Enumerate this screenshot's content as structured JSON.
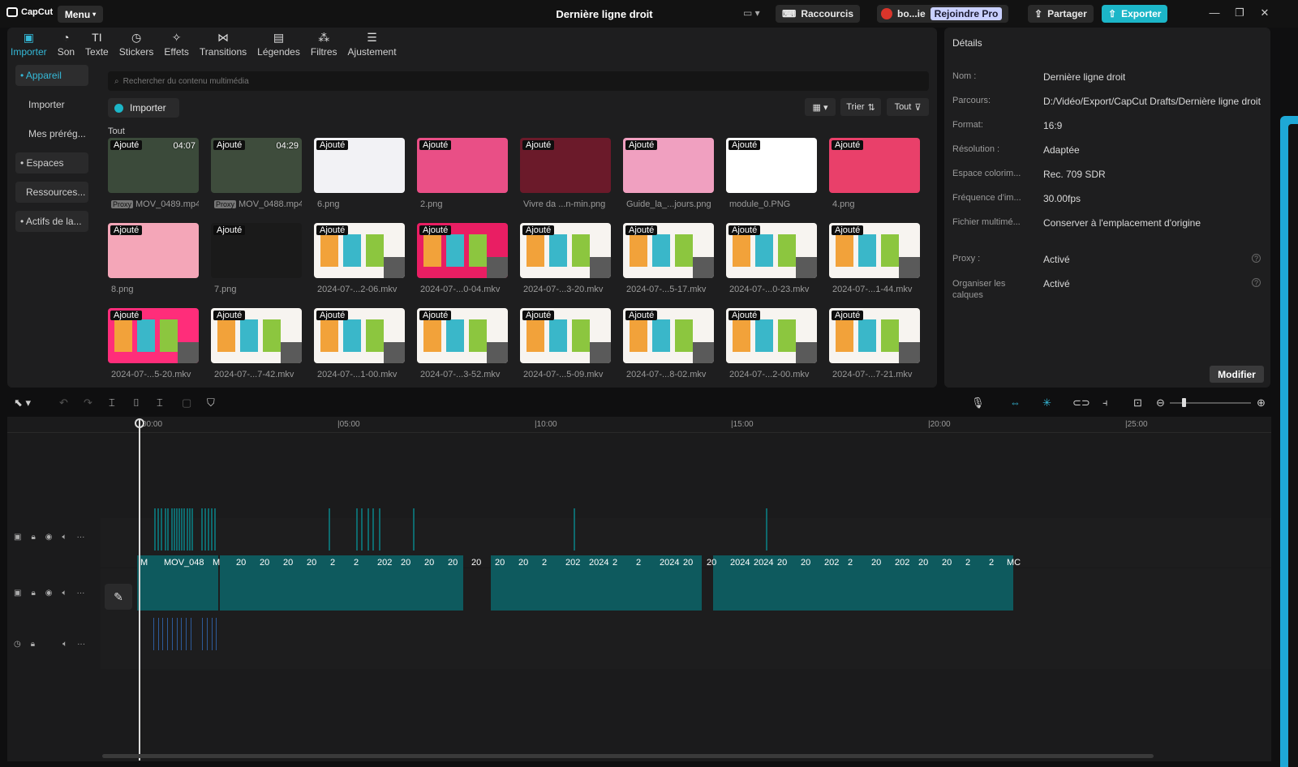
{
  "app": {
    "name": "CapCut",
    "menu": "Menu",
    "title": "Dernière ligne droit"
  },
  "titlebar": {
    "shortcuts": "Raccourcis",
    "account": "bo...ie",
    "join_pro": "Rejoindre Pro",
    "share": "Partager",
    "export": "Exporter"
  },
  "tools": [
    {
      "label": "Importer",
      "icon": "import-icon"
    },
    {
      "label": "Son",
      "icon": "audio-icon"
    },
    {
      "label": "Texte",
      "icon": "text-icon"
    },
    {
      "label": "Stickers",
      "icon": "sticker-icon"
    },
    {
      "label": "Effets",
      "icon": "effects-icon"
    },
    {
      "label": "Transitions",
      "icon": "transitions-icon"
    },
    {
      "label": "Légendes",
      "icon": "captions-icon"
    },
    {
      "label": "Filtres",
      "icon": "filters-icon"
    },
    {
      "label": "Ajustement",
      "icon": "adjust-icon"
    }
  ],
  "sidebar": [
    {
      "label": "• Appareil"
    },
    {
      "label": "Importer"
    },
    {
      "label": "Mes prérég..."
    },
    {
      "label": "• Espaces"
    },
    {
      "label": "Ressources..."
    },
    {
      "label": "• Actifs de la..."
    }
  ],
  "media": {
    "search_placeholder": "Rechercher du contenu multimédia",
    "import_label": "Importer",
    "sort_label": "Trier",
    "filter_label": "Tout",
    "section_label": "Tout",
    "badge": "Ajouté",
    "proxy": "Proxy",
    "items": [
      {
        "name": "MOV_0489.mp4",
        "duration": "04:07",
        "proxy": true
      },
      {
        "name": "MOV_0488.mp4",
        "duration": "04:29",
        "proxy": true
      },
      {
        "name": "6.png"
      },
      {
        "name": "2.png"
      },
      {
        "name": "Vivre da ...n-min.png"
      },
      {
        "name": "Guide_la_...jours.png"
      },
      {
        "name": "module_0.PNG"
      },
      {
        "name": "4.png"
      },
      {
        "name": "8.png"
      },
      {
        "name": "7.png"
      },
      {
        "name": "2024-07-...2-06.mkv"
      },
      {
        "name": "2024-07-...0-04.mkv"
      },
      {
        "name": "2024-07-...3-20.mkv"
      },
      {
        "name": "2024-07-...5-17.mkv"
      },
      {
        "name": "2024-07-...0-23.mkv"
      },
      {
        "name": "2024-07-...1-44.mkv"
      },
      {
        "name": "2024-07-...5-20.mkv"
      },
      {
        "name": "2024-07-...7-42.mkv"
      },
      {
        "name": "2024-07-...1-00.mkv"
      },
      {
        "name": "2024-07-...3-52.mkv"
      },
      {
        "name": "2024-07-...5-09.mkv"
      },
      {
        "name": "2024-07-...8-02.mkv"
      },
      {
        "name": "2024-07-...2-00.mkv"
      },
      {
        "name": "2024-07-...7-21.mkv"
      }
    ]
  },
  "details": {
    "title": "Détails",
    "rows": [
      {
        "k": "Nom :",
        "v": "Dernière ligne droit"
      },
      {
        "k": "Parcours:",
        "v": "D:/Vidéo/Export/CapCut Drafts/Dernière ligne droit"
      },
      {
        "k": "Format:",
        "v": "16:9"
      },
      {
        "k": "Résolution :",
        "v": "Adaptée"
      },
      {
        "k": "Espace colorim...",
        "v": "Rec. 709 SDR"
      },
      {
        "k": "Fréquence d'im...",
        "v": "30.00fps"
      },
      {
        "k": "Fichier multimé...",
        "v": "Conserver à l'emplacement d'origine"
      },
      {
        "k": "Proxy :",
        "v": "Activé"
      },
      {
        "k": "Organiser les calques",
        "v": "Activé"
      }
    ],
    "modify": "Modifier"
  },
  "timeline": {
    "ticks": [
      "00:00",
      "|05:00",
      "|10:00",
      "|15:00",
      "|20:00",
      "|25:00"
    ],
    "clip_labels": [
      "M",
      "MOV_048",
      "M",
      "20",
      "20",
      "20",
      "20",
      "2",
      "2",
      "202",
      "20",
      "20",
      "20",
      "20",
      "20",
      "20",
      "2",
      "202",
      "2024",
      "2",
      "2",
      "2024",
      "20",
      "20",
      "2024",
      "2024",
      "20",
      "20",
      "202",
      "2",
      "20",
      "202",
      "20",
      "20",
      "2",
      "2",
      "MC"
    ]
  },
  "colors": {
    "accent": "#35b9d8",
    "export": "#1cb6c8",
    "clip": "#0e6a6e"
  }
}
